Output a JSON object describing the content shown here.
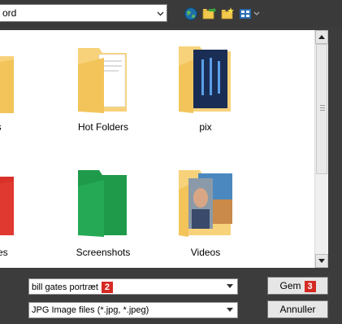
{
  "toolbar": {
    "path_text": "ord",
    "icons": [
      "globe-icon",
      "back-folder-icon",
      "new-folder-icon",
      "view-icon"
    ]
  },
  "items": [
    {
      "label": "ders"
    },
    {
      "label": "Hot Folders"
    },
    {
      "label": "pix"
    },
    {
      "label": "ammes"
    },
    {
      "label": "Screenshots"
    },
    {
      "label": "Videos"
    }
  ],
  "filename": {
    "value": "bill gates portræt",
    "badge": "2"
  },
  "filetype": {
    "value": "JPG Image files (*.jpg, *.jpeg)"
  },
  "buttons": {
    "save_label": "Gem",
    "save_badge": "3",
    "cancel_label": "Annuller"
  },
  "colors": {
    "accent_badge": "#d42a23",
    "folder": "#f5d27a",
    "dark": "#3c3c3c"
  }
}
